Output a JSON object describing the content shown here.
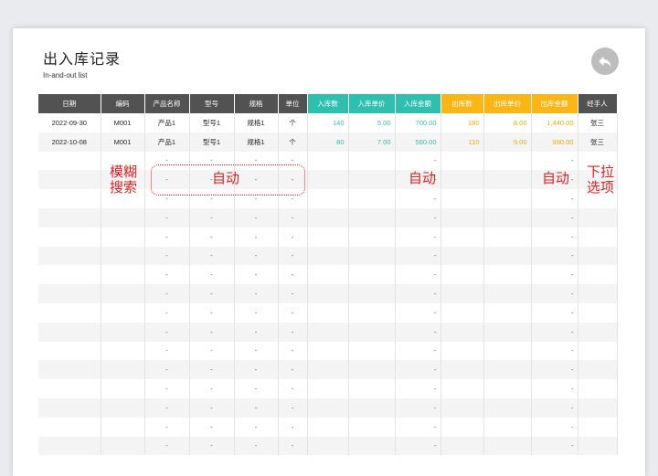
{
  "page": {
    "title": "出入库记录",
    "subtitle": "In-and-out list",
    "back_icon": "back-arrow-icon"
  },
  "colors": {
    "header_dark": "#525252",
    "inbound_teal": "#2ebfae",
    "outbound_orange": "#fbb616",
    "annotation_red": "#e02222"
  },
  "table": {
    "headers": [
      "日期",
      "编码",
      "产品名称",
      "型号",
      "规格",
      "单位",
      "入库数",
      "入库单价",
      "入库金额",
      "出库数",
      "出库单价",
      "出库金额",
      "经手人"
    ],
    "rows": [
      [
        "2022-09-30",
        "M001",
        "产品1",
        "型号1",
        "规格1",
        "个",
        "140",
        "5.00",
        "700.00",
        "180",
        "8.00",
        "1,440.00",
        "张三"
      ],
      [
        "2022-10-08",
        "M001",
        "产品1",
        "型号1",
        "规格1",
        "个",
        "80",
        "7.00",
        "560.00",
        "110",
        "9.00",
        "990.00",
        "张三"
      ]
    ],
    "empty_row_mark": "-",
    "empty_row_count": 16
  },
  "annotations": {
    "fuzzy_search": "模糊\n搜索",
    "auto_1": "自动",
    "auto_2": "自动",
    "auto_3": "自动",
    "dropdown": "下拉\n选项"
  }
}
